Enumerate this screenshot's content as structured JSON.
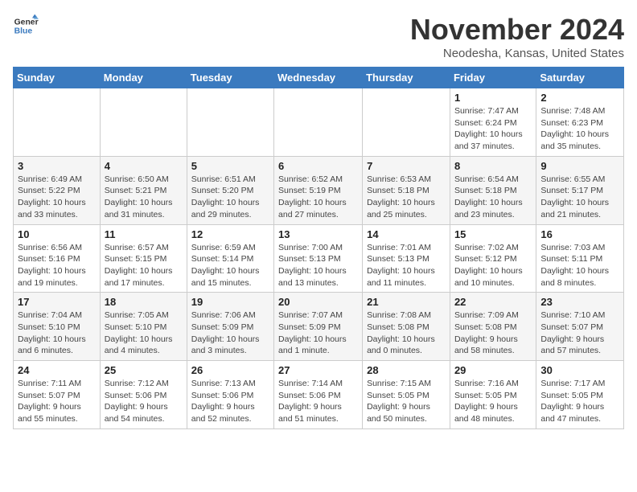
{
  "logo": {
    "line1": "General",
    "line2": "Blue"
  },
  "header": {
    "month": "November 2024",
    "location": "Neodesha, Kansas, United States"
  },
  "weekdays": [
    "Sunday",
    "Monday",
    "Tuesday",
    "Wednesday",
    "Thursday",
    "Friday",
    "Saturday"
  ],
  "weeks": [
    [
      {
        "day": "",
        "detail": ""
      },
      {
        "day": "",
        "detail": ""
      },
      {
        "day": "",
        "detail": ""
      },
      {
        "day": "",
        "detail": ""
      },
      {
        "day": "",
        "detail": ""
      },
      {
        "day": "1",
        "detail": "Sunrise: 7:47 AM\nSunset: 6:24 PM\nDaylight: 10 hours and 37 minutes."
      },
      {
        "day": "2",
        "detail": "Sunrise: 7:48 AM\nSunset: 6:23 PM\nDaylight: 10 hours and 35 minutes."
      }
    ],
    [
      {
        "day": "3",
        "detail": "Sunrise: 6:49 AM\nSunset: 5:22 PM\nDaylight: 10 hours and 33 minutes."
      },
      {
        "day": "4",
        "detail": "Sunrise: 6:50 AM\nSunset: 5:21 PM\nDaylight: 10 hours and 31 minutes."
      },
      {
        "day": "5",
        "detail": "Sunrise: 6:51 AM\nSunset: 5:20 PM\nDaylight: 10 hours and 29 minutes."
      },
      {
        "day": "6",
        "detail": "Sunrise: 6:52 AM\nSunset: 5:19 PM\nDaylight: 10 hours and 27 minutes."
      },
      {
        "day": "7",
        "detail": "Sunrise: 6:53 AM\nSunset: 5:18 PM\nDaylight: 10 hours and 25 minutes."
      },
      {
        "day": "8",
        "detail": "Sunrise: 6:54 AM\nSunset: 5:18 PM\nDaylight: 10 hours and 23 minutes."
      },
      {
        "day": "9",
        "detail": "Sunrise: 6:55 AM\nSunset: 5:17 PM\nDaylight: 10 hours and 21 minutes."
      }
    ],
    [
      {
        "day": "10",
        "detail": "Sunrise: 6:56 AM\nSunset: 5:16 PM\nDaylight: 10 hours and 19 minutes."
      },
      {
        "day": "11",
        "detail": "Sunrise: 6:57 AM\nSunset: 5:15 PM\nDaylight: 10 hours and 17 minutes."
      },
      {
        "day": "12",
        "detail": "Sunrise: 6:59 AM\nSunset: 5:14 PM\nDaylight: 10 hours and 15 minutes."
      },
      {
        "day": "13",
        "detail": "Sunrise: 7:00 AM\nSunset: 5:13 PM\nDaylight: 10 hours and 13 minutes."
      },
      {
        "day": "14",
        "detail": "Sunrise: 7:01 AM\nSunset: 5:13 PM\nDaylight: 10 hours and 11 minutes."
      },
      {
        "day": "15",
        "detail": "Sunrise: 7:02 AM\nSunset: 5:12 PM\nDaylight: 10 hours and 10 minutes."
      },
      {
        "day": "16",
        "detail": "Sunrise: 7:03 AM\nSunset: 5:11 PM\nDaylight: 10 hours and 8 minutes."
      }
    ],
    [
      {
        "day": "17",
        "detail": "Sunrise: 7:04 AM\nSunset: 5:10 PM\nDaylight: 10 hours and 6 minutes."
      },
      {
        "day": "18",
        "detail": "Sunrise: 7:05 AM\nSunset: 5:10 PM\nDaylight: 10 hours and 4 minutes."
      },
      {
        "day": "19",
        "detail": "Sunrise: 7:06 AM\nSunset: 5:09 PM\nDaylight: 10 hours and 3 minutes."
      },
      {
        "day": "20",
        "detail": "Sunrise: 7:07 AM\nSunset: 5:09 PM\nDaylight: 10 hours and 1 minute."
      },
      {
        "day": "21",
        "detail": "Sunrise: 7:08 AM\nSunset: 5:08 PM\nDaylight: 10 hours and 0 minutes."
      },
      {
        "day": "22",
        "detail": "Sunrise: 7:09 AM\nSunset: 5:08 PM\nDaylight: 9 hours and 58 minutes."
      },
      {
        "day": "23",
        "detail": "Sunrise: 7:10 AM\nSunset: 5:07 PM\nDaylight: 9 hours and 57 minutes."
      }
    ],
    [
      {
        "day": "24",
        "detail": "Sunrise: 7:11 AM\nSunset: 5:07 PM\nDaylight: 9 hours and 55 minutes."
      },
      {
        "day": "25",
        "detail": "Sunrise: 7:12 AM\nSunset: 5:06 PM\nDaylight: 9 hours and 54 minutes."
      },
      {
        "day": "26",
        "detail": "Sunrise: 7:13 AM\nSunset: 5:06 PM\nDaylight: 9 hours and 52 minutes."
      },
      {
        "day": "27",
        "detail": "Sunrise: 7:14 AM\nSunset: 5:06 PM\nDaylight: 9 hours and 51 minutes."
      },
      {
        "day": "28",
        "detail": "Sunrise: 7:15 AM\nSunset: 5:05 PM\nDaylight: 9 hours and 50 minutes."
      },
      {
        "day": "29",
        "detail": "Sunrise: 7:16 AM\nSunset: 5:05 PM\nDaylight: 9 hours and 48 minutes."
      },
      {
        "day": "30",
        "detail": "Sunrise: 7:17 AM\nSunset: 5:05 PM\nDaylight: 9 hours and 47 minutes."
      }
    ]
  ]
}
